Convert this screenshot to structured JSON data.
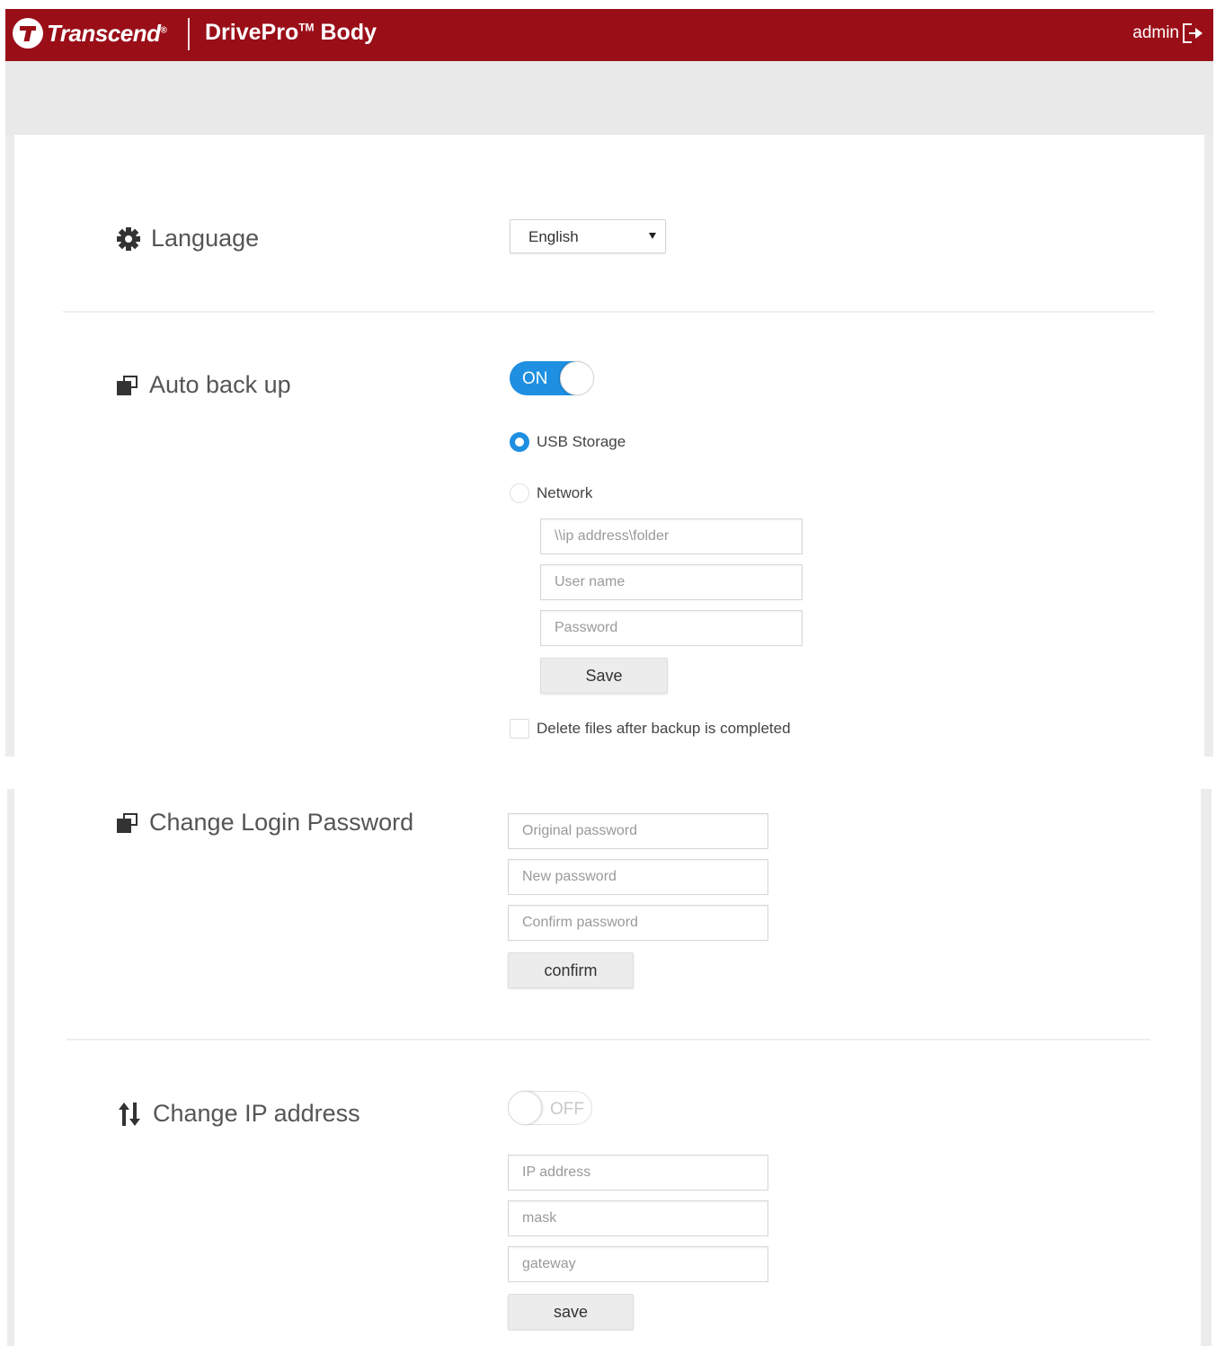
{
  "header": {
    "brand": "Transcend",
    "product": "DrivePro",
    "product_tm": "TM",
    "product_suffix": "Body",
    "user": "admin"
  },
  "language": {
    "label": "Language",
    "selected": "English"
  },
  "auto_backup": {
    "label": "Auto back up",
    "toggle_label": "ON",
    "options": [
      "USB Storage",
      "Network"
    ],
    "path_placeholder": "\\\\ip address\\folder",
    "username_placeholder": "User name",
    "password_placeholder": "Password",
    "save_label": "Save",
    "delete_label": "Delete files after backup is completed"
  },
  "change_password": {
    "label": "Change Login Password",
    "original_placeholder": "Original password",
    "new_placeholder": "New password",
    "confirm_placeholder": "Confirm password",
    "confirm_label": "confirm"
  },
  "change_ip": {
    "label": "Change IP address",
    "toggle_label": "OFF",
    "ip_placeholder": "IP address",
    "mask_placeholder": "mask",
    "gateway_placeholder": "gateway",
    "save_label": "save"
  },
  "colors": {
    "header": "#9a0e18",
    "accent": "#1e8fe1"
  },
  "icons": {
    "language": "gear-icon",
    "auto_backup": "copy-icon",
    "change_password": "copy-icon",
    "change_ip": "up-down-arrows-icon",
    "logout": "logout-icon"
  }
}
